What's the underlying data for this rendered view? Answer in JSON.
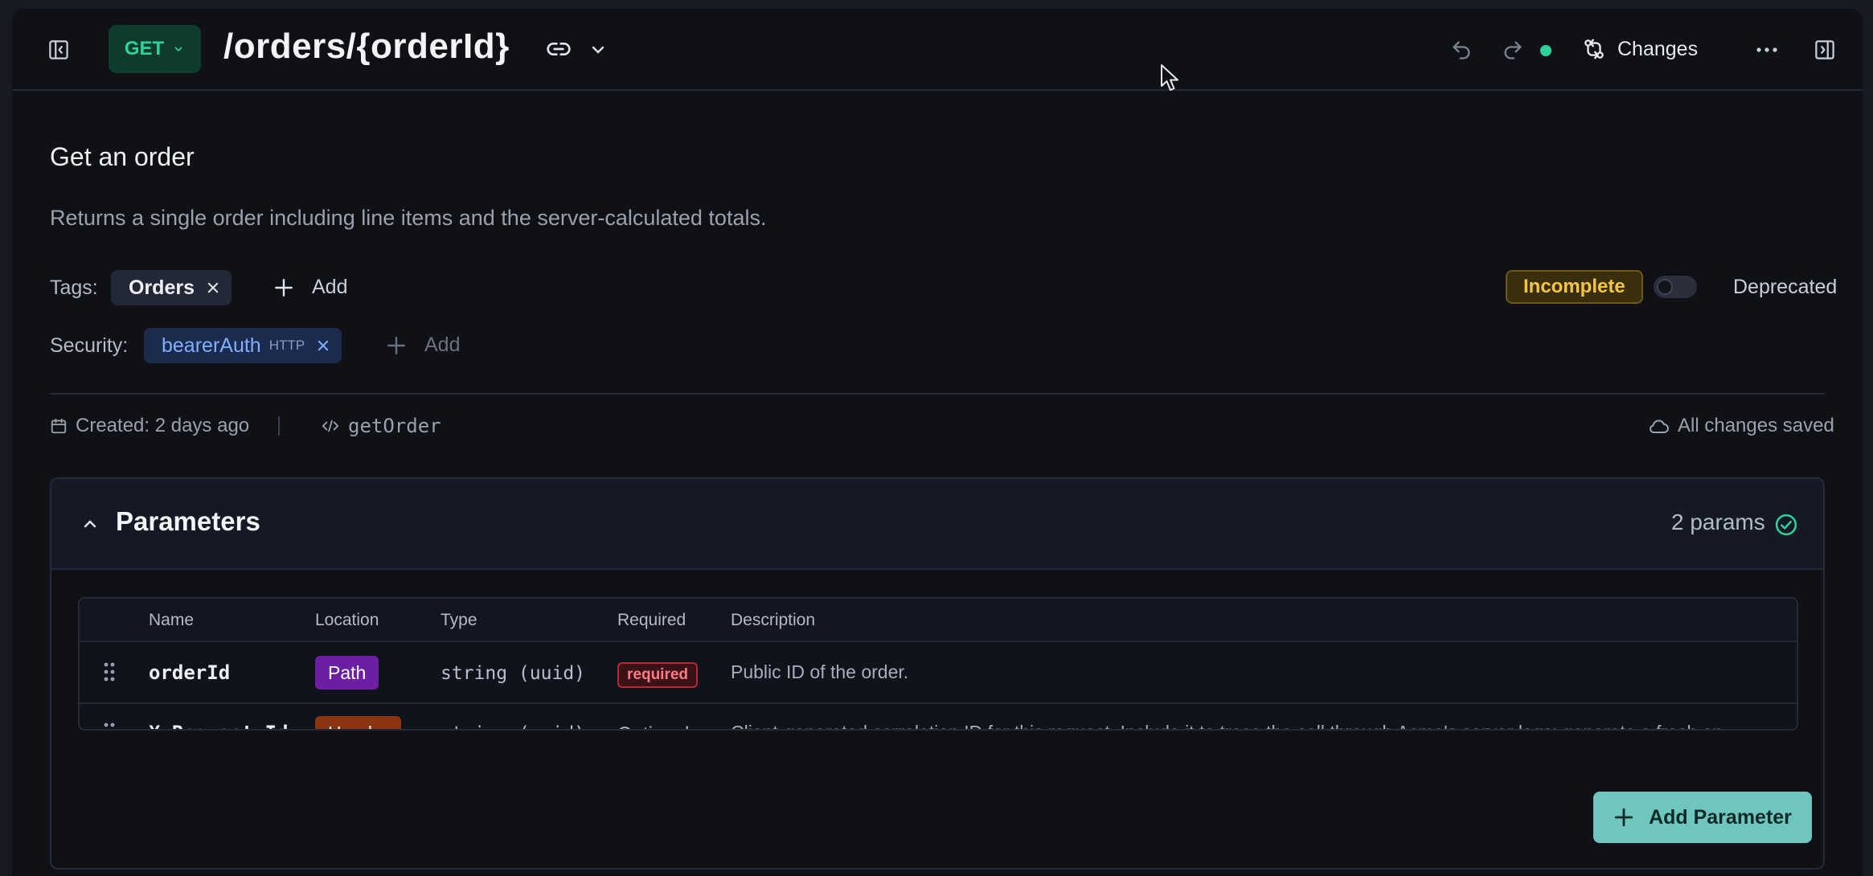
{
  "header": {
    "method": "GET",
    "path": "/orders/{orderId}",
    "changes_label": "Changes",
    "status_color": "#2fd39a"
  },
  "operation": {
    "title": "Get an order",
    "description": "Returns a single order including line items and the server-calculated totals.",
    "tags_label": "Tags:",
    "tags": [
      {
        "label": "Orders"
      }
    ],
    "add_tag_label": "Add",
    "security_label": "Security:",
    "security": [
      {
        "label": "bearerAuth",
        "kind": "HTTP"
      }
    ],
    "add_security_label": "Add",
    "status_badge": "Incomplete",
    "deprecated_label": "Deprecated",
    "deprecated": false,
    "created": "Created: 2 days ago",
    "operation_id": "getOrder",
    "save_status": "All changes saved"
  },
  "parameters": {
    "title": "Parameters",
    "count_label": "2 params",
    "columns": [
      "Name",
      "Location",
      "Type",
      "Required",
      "Description"
    ],
    "rows": [
      {
        "name": "orderId",
        "location": "Path",
        "location_color": "#6d1fa3",
        "type": "string (uuid)",
        "required": "required",
        "description": "Public ID of the order."
      },
      {
        "name": "X-Request-Id",
        "location": "Header",
        "location_color": "#8a3412",
        "type": "string (uuid)",
        "required": "Optional",
        "description": "Client-generated correlation ID for this request. Include it to trace the call through Acme's server logs; generate a fresh on"
      }
    ],
    "add_button_label": "Add Parameter"
  }
}
